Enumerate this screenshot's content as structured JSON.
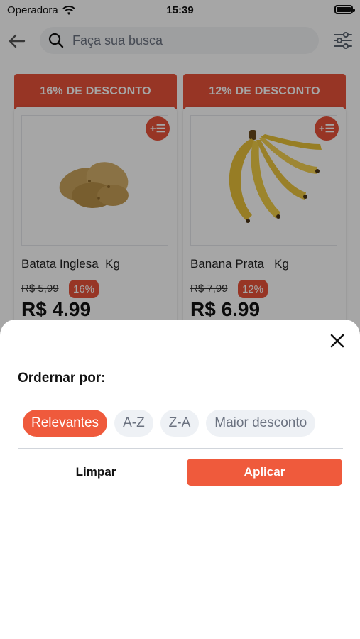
{
  "status_bar": {
    "carrier": "Operadora",
    "time": "15:39"
  },
  "header": {
    "search_placeholder": "Faça sua busca"
  },
  "products": [
    {
      "banner": "16% DE DESCONTO",
      "name": "Batata Inglesa  Kg",
      "old_price": "R$ 5,99",
      "badge": "16%",
      "price": "R$ 4.99",
      "add_label": "+☰"
    },
    {
      "banner": "12% DE DESCONTO",
      "name": "Banana Prata   Kg",
      "old_price": "R$ 7,99",
      "badge": "12%",
      "price": "R$ 6.99",
      "add_label": "+☰"
    }
  ],
  "sort_sheet": {
    "title": "Ordernar por:",
    "options": [
      "Relevantes",
      "A-Z",
      "Z-A",
      "Maior desconto"
    ],
    "selected": "Relevantes",
    "clear_label": "Limpar",
    "apply_label": "Aplicar"
  },
  "colors": {
    "accent": "#ef5a3c",
    "banner": "#e8523a",
    "chip_bg": "#eef1f5"
  }
}
